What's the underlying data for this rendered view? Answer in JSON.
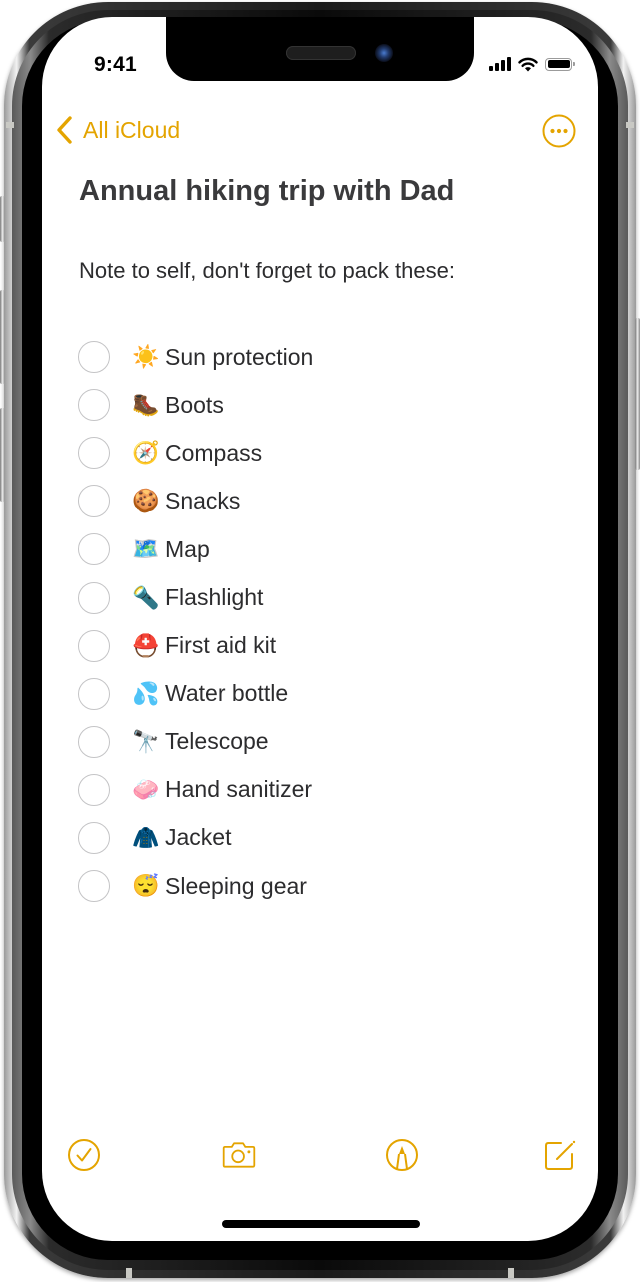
{
  "device": {
    "frame_color": "#1a1a1a",
    "screen_color": "#ffffff"
  },
  "status_bar": {
    "time": "9:41",
    "signal_bars": 4,
    "wifi": true,
    "battery_level": 1.0
  },
  "nav": {
    "back_label": "All iCloud",
    "back_icon": "chevron-left-icon",
    "more_icon": "ellipsis-circle-icon",
    "accent_color": "#e4a400"
  },
  "note": {
    "title": "Annual hiking trip with Dad",
    "intro": "Note to self, don't forget to pack these:",
    "checklist": [
      {
        "emoji": "☀️",
        "label": "Sun protection",
        "checked": false
      },
      {
        "emoji": "🥾",
        "label": "Boots",
        "checked": false
      },
      {
        "emoji": "🧭",
        "label": "Compass",
        "checked": false
      },
      {
        "emoji": "🍪",
        "label": "Snacks",
        "checked": false
      },
      {
        "emoji": "🗺️",
        "label": "Map",
        "checked": false
      },
      {
        "emoji": "🔦",
        "label": "Flashlight",
        "checked": false
      },
      {
        "emoji": "⛑️",
        "label": "First aid kit",
        "checked": false
      },
      {
        "emoji": "💦",
        "label": "Water bottle",
        "checked": false
      },
      {
        "emoji": "🔭",
        "label": "Telescope",
        "checked": false
      },
      {
        "emoji": "🧼",
        "label": "Hand sanitizer",
        "checked": false
      },
      {
        "emoji": "🧥",
        "label": "Jacket",
        "checked": false
      },
      {
        "emoji": "😴",
        "label": "Sleeping gear",
        "checked": false
      }
    ]
  },
  "toolbar": {
    "items": [
      {
        "name": "checklist",
        "icon": "checkmark-circle-icon"
      },
      {
        "name": "camera",
        "icon": "camera-icon"
      },
      {
        "name": "markup",
        "icon": "pen-tip-circle-icon"
      },
      {
        "name": "compose",
        "icon": "compose-icon"
      }
    ]
  }
}
